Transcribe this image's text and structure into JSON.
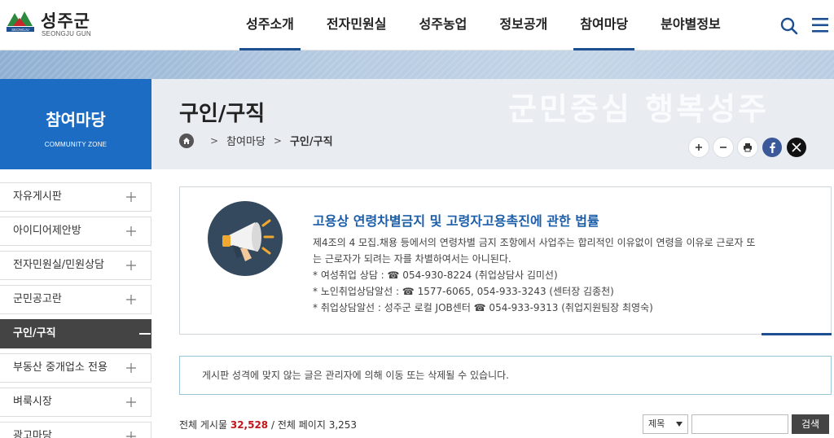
{
  "header": {
    "logo_title": "성주군",
    "logo_sub": "SEONGJU GUN",
    "logo_mark_text": "SEONGJU",
    "nav": [
      {
        "label": "성주소개",
        "active": true
      },
      {
        "label": "전자민원실",
        "active": false
      },
      {
        "label": "성주농업",
        "active": false
      },
      {
        "label": "정보공개",
        "active": false
      },
      {
        "label": "참여마당",
        "active": true
      },
      {
        "label": "분야별정보",
        "active": false
      }
    ],
    "accent_color": "#1d4f91"
  },
  "visual": {
    "section_title": "참여마당",
    "section_sub": "COMMUNITY ZONE",
    "slogan": "군민중심 행복성주",
    "page_title": "구인/구직",
    "breadcrumb": [
      "참여마당",
      "구인/구직"
    ]
  },
  "sidebar": {
    "items": [
      {
        "label": "자유게시판",
        "active": false
      },
      {
        "label": "아이디어제안방",
        "active": false
      },
      {
        "label": "전자민원실/민원상담",
        "active": false
      },
      {
        "label": "군민공고란",
        "active": false
      },
      {
        "label": "구인/구직",
        "active": true
      },
      {
        "label": "부동산 중개업소 전용",
        "active": false
      },
      {
        "label": "벼룩시장",
        "active": false
      },
      {
        "label": "광고마당",
        "active": false
      }
    ]
  },
  "notice": {
    "title": "고용상 연령차별금지 및 고령자고용촉진에 관한 법률",
    "lines": [
      "제4조의 4 모집.채용 등에서의 연령차별 금지 조항에서 사업주는 합리적인 이유없이 연령을 이유로 근로자 또",
      "는 근로자가 되려는 자를 차별하여서는 아니된다.",
      "* 여성취업 상담 : ☎ 054-930-8224 (취업상담사 김미선)",
      "* 노인취업상담알선 : ☎ 1577-6065, 054-933-3243 (센터장 김종천)",
      "* 취업상담알선 : 성주군 로컬 JOB센터 ☎ 054-933-9313 (취업지원팀장 최영숙)"
    ]
  },
  "warning": "게시판 성격에 맞지 않는 글은 관리자에 의해 이동 또는 삭제될 수 있습니다.",
  "board": {
    "total_label": "전체 게시물",
    "total_posts": "32,528",
    "pages_label": "/ 전체 페이지",
    "total_pages": "3,253",
    "search_field": "제목",
    "search_value": "",
    "search_button": "검색"
  }
}
